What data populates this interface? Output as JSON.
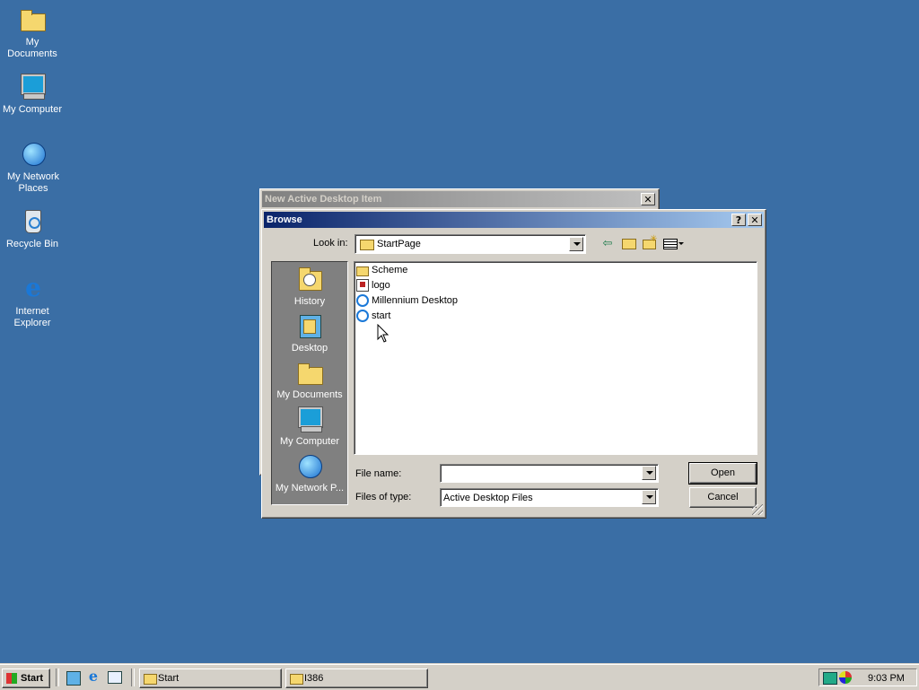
{
  "desktop": {
    "icons": [
      {
        "label": "My Documents",
        "icon": "my-documents-icon"
      },
      {
        "label": "My Computer",
        "icon": "my-computer-icon"
      },
      {
        "label": "My Network Places",
        "icon": "network-places-icon"
      },
      {
        "label": "Recycle Bin",
        "icon": "recycle-bin-icon"
      },
      {
        "label": "Internet Explorer",
        "icon": "internet-explorer-icon"
      }
    ],
    "background_color": "#3a6ea5"
  },
  "back_window": {
    "title": "New Active Desktop Item"
  },
  "browse_dialog": {
    "title": "Browse",
    "help_glyph": "?",
    "close_glyph": "✕",
    "look_in_label": "Look in:",
    "look_in_value": "StartPage",
    "places": [
      {
        "label": "History",
        "icon": "history-icon"
      },
      {
        "label": "Desktop",
        "icon": "desktop-icon"
      },
      {
        "label": "My Documents",
        "icon": "my-documents-icon"
      },
      {
        "label": "My Computer",
        "icon": "my-computer-icon"
      },
      {
        "label": "My Network P...",
        "icon": "network-places-icon"
      }
    ],
    "files": [
      {
        "name": "Scheme",
        "icon": "folder-icon"
      },
      {
        "name": "logo",
        "icon": "image-file-icon"
      },
      {
        "name": "Millennium Desktop",
        "icon": "html-file-icon"
      },
      {
        "name": "start",
        "icon": "html-file-icon"
      }
    ],
    "file_name_label": "File name:",
    "file_name_value": "",
    "files_of_type_label": "Files of type:",
    "files_of_type_value": "Active Desktop Files",
    "open_label": "Open",
    "cancel_label": "Cancel"
  },
  "taskbar": {
    "start_label": "Start",
    "tasks": [
      {
        "label": "Start",
        "icon": "folder-icon"
      },
      {
        "label": "I386",
        "icon": "folder-icon"
      }
    ],
    "clock": "9:03 PM"
  }
}
